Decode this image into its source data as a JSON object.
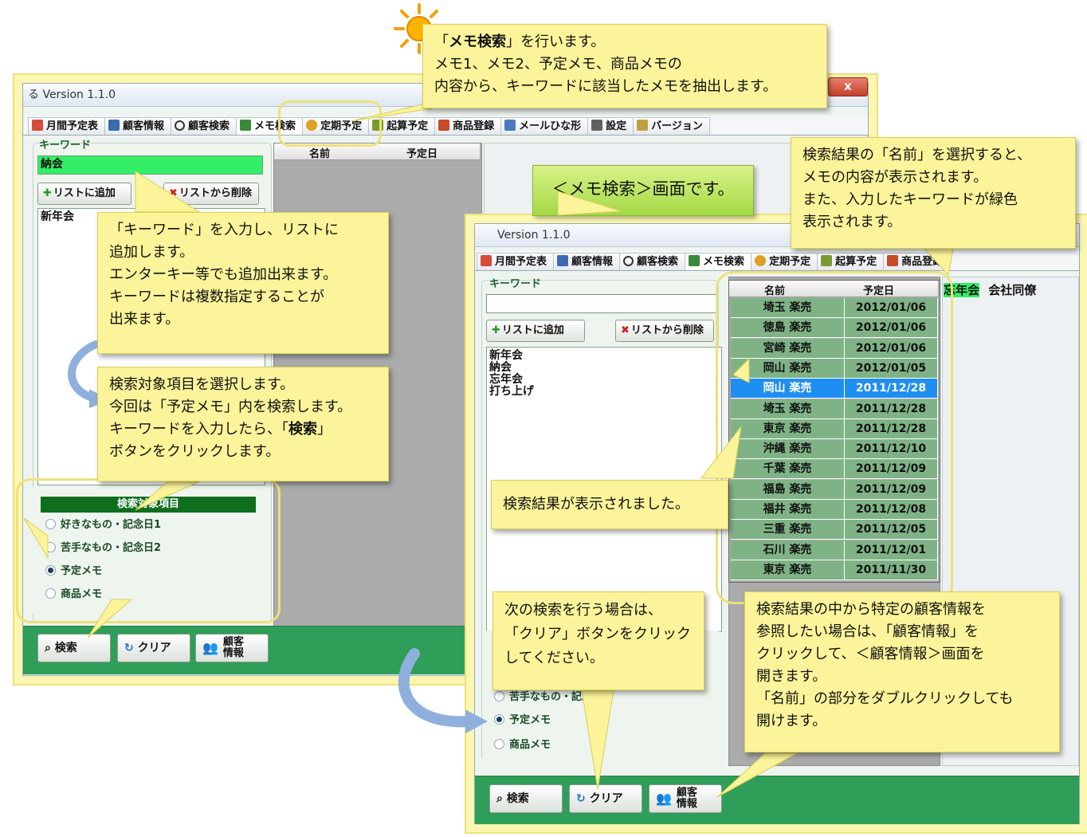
{
  "left_window": {
    "title": "る Version 1.1.0",
    "close_label": "x",
    "tabs": [
      "月間予定表",
      "顧客情報",
      "顧客検索",
      "メモ検索",
      "定期予定",
      "起算予定",
      "商品登録",
      "メールひな形",
      "設定",
      "バージョン"
    ],
    "keyword_label": "キーワード",
    "keyword_value": "納会",
    "add_button": "リストに追加",
    "remove_button": "リストから削除",
    "keyword_list": [
      "新年会"
    ],
    "col_name": "名前",
    "col_date": "予定日",
    "target_title": "検索対象項目",
    "targets": [
      "好きなもの・記念日1",
      "苦手なもの・記念日2",
      "予定メモ",
      "商品メモ"
    ],
    "selected_target": "予定メモ",
    "search_button": "検索",
    "clear_button": "クリア",
    "customer_button_l1": "顧客",
    "customer_button_l2": "情報"
  },
  "right_window": {
    "title": "Version 1.1.0",
    "tabs": [
      "月間予定表",
      "顧客情報",
      "顧客検索",
      "メモ検索",
      "定期予定",
      "起算予定",
      "商品登録"
    ],
    "keyword_label": "キーワード",
    "keyword_value": "",
    "add_button": "リストに追加",
    "remove_button": "リストから削除",
    "keyword_list": [
      "新年会",
      "納会",
      "忘年会",
      "打ち上げ"
    ],
    "targets_visible": [
      "苦手なもの・記念日2",
      "予定メモ",
      "商品メモ"
    ],
    "col_name": "名前",
    "col_date": "予定日",
    "results": [
      {
        "name": "埼玉 楽売",
        "date": "2012/01/06"
      },
      {
        "name": "徳島 楽売",
        "date": "2012/01/06"
      },
      {
        "name": "宮崎 楽売",
        "date": "2012/01/06"
      },
      {
        "name": "岡山 楽売",
        "date": "2012/01/05"
      },
      {
        "name": "岡山 楽売",
        "date": "2011/12/28",
        "selected": true
      },
      {
        "name": "埼玉 楽売",
        "date": "2011/12/28"
      },
      {
        "name": "東京 楽売",
        "date": "2011/12/28"
      },
      {
        "name": "沖縄 楽売",
        "date": "2011/12/10"
      },
      {
        "name": "千葉 楽売",
        "date": "2011/12/09"
      },
      {
        "name": "福島 楽売",
        "date": "2011/12/09"
      },
      {
        "name": "福井 楽売",
        "date": "2011/12/08"
      },
      {
        "name": "三重 楽売",
        "date": "2011/12/05"
      },
      {
        "name": "石川 楽売",
        "date": "2011/12/01"
      },
      {
        "name": "東京 楽売",
        "date": "2011/11/30"
      }
    ],
    "memo_highlight": "忘年会",
    "memo_rest": "会社同僚",
    "search_button": "検索",
    "clear_button": "クリア",
    "customer_button_l1": "顧客",
    "customer_button_l2": "情報"
  },
  "banner": "＜メモ検索＞画面です。",
  "callouts": {
    "top_bold": "メモ検索",
    "top_pre": "「",
    "top_post": "」を行います。",
    "top_l2": "メモ1、メモ2、予定メモ、商品メモの",
    "top_l3": "内容から、キーワードに該当したメモを抽出します。",
    "keyword": [
      "「キーワード」を入力し、リストに",
      "追加します。",
      "エンターキー等でも追加出来ます。",
      "キーワードは複数指定することが",
      "出来ます。"
    ],
    "target_l1": "検索対象項目を選択します。",
    "target_l2": "今回は「予定メモ」内を検索します。",
    "target_l3_pre": "キーワードを入力したら、「",
    "target_l3_bold": "検索",
    "target_l3_post": "」",
    "target_l4": "ボタンをクリックします。",
    "result_name": [
      "検索結果の「名前」を選択すると、",
      "メモの内容が表示されます。",
      "また、入力したキーワードが緑色",
      "表示されます。"
    ],
    "results_shown": "検索結果が表示されました。",
    "clear": [
      "次の検索を行う場合は、",
      "「クリア」ボタンをクリック",
      "してください。"
    ],
    "customer": [
      "検索結果の中から特定の顧客情報を",
      "参照したい場合は、「顧客情報」を",
      "クリックして、＜顧客情報＞画面を",
      "開きます。",
      "「名前」の部分をダブルクリックしても",
      "開けます。"
    ]
  },
  "colors": {
    "callout": "#fbf49a",
    "banner": "#b8e25a",
    "keyword_match": "#33ee66",
    "selected_row": "#1f8ef2",
    "result_row": "#7fb386",
    "bottom_bar": "#2e9e58",
    "target_header": "#0e6e1e"
  }
}
